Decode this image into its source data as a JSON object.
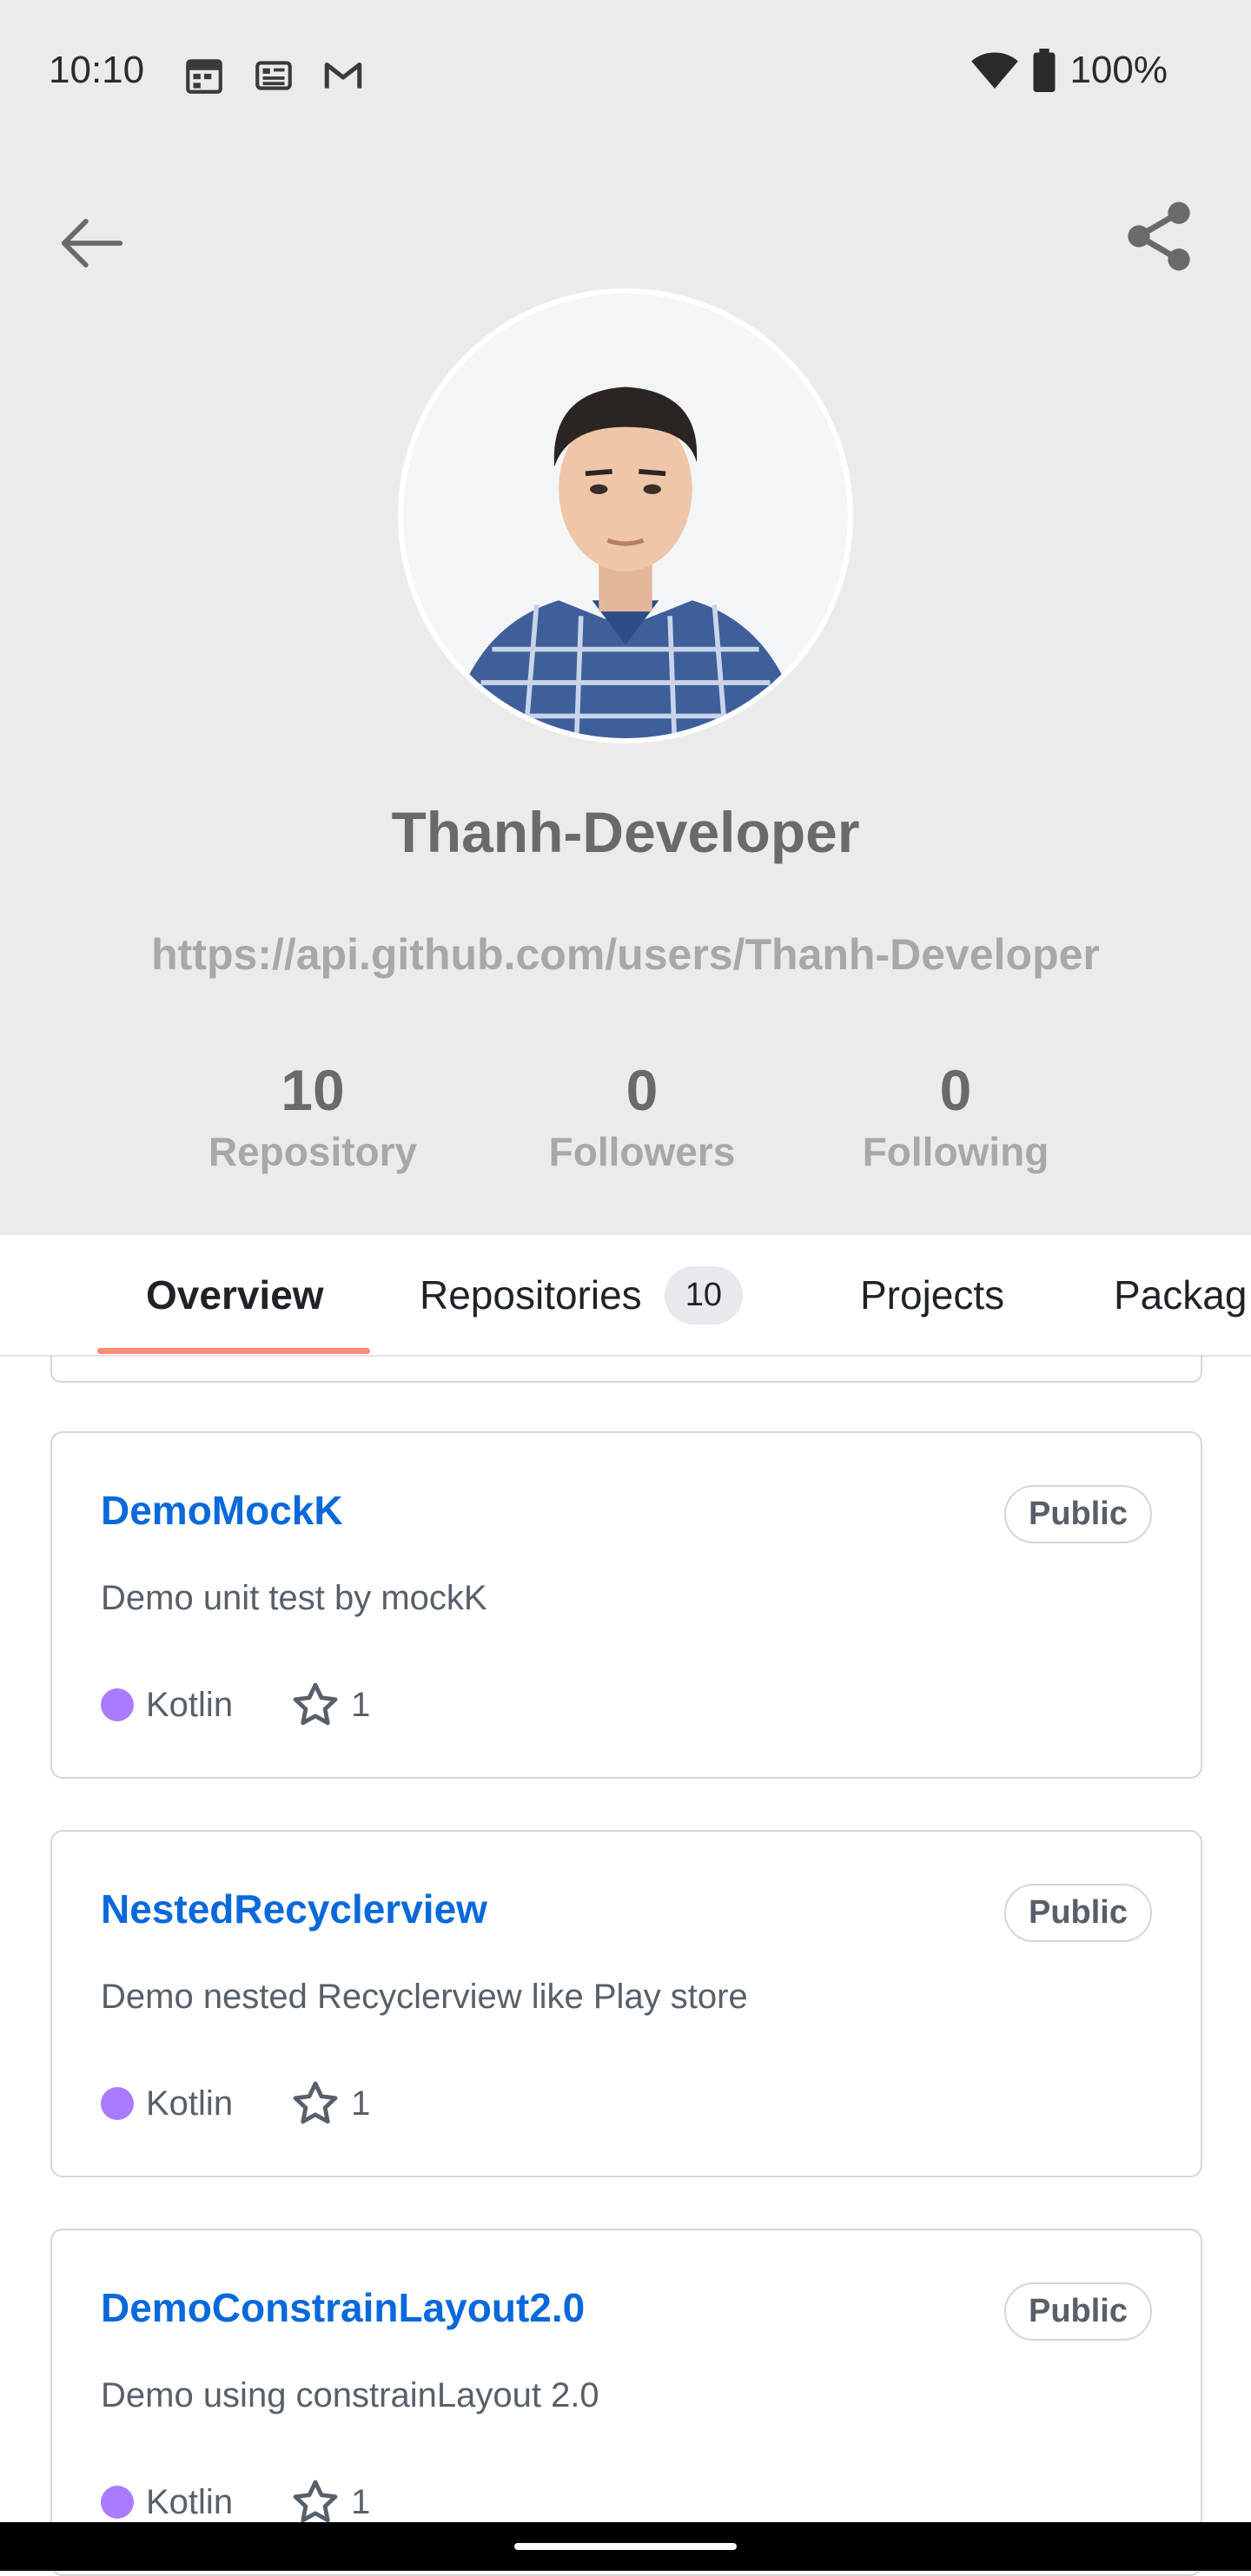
{
  "status_bar": {
    "time": "10:10",
    "battery_percent": "100%",
    "left_icons": [
      "calendar-icon",
      "news-icon",
      "gmail-icon"
    ],
    "right_icons": [
      "wifi-icon",
      "battery-icon"
    ]
  },
  "profile": {
    "username": "Thanh-Developer",
    "url": "https://api.github.com/users/Thanh-Developer",
    "stats": [
      {
        "value": "10",
        "label": "Repository"
      },
      {
        "value": "0",
        "label": "Followers"
      },
      {
        "value": "0",
        "label": "Following"
      }
    ]
  },
  "tabs": {
    "items": [
      {
        "label": "Overview",
        "active": true
      },
      {
        "label": "Repositories",
        "count": "10"
      },
      {
        "label": "Projects"
      },
      {
        "label": "Packag"
      }
    ]
  },
  "repos": [
    {
      "name": "DemoMockK",
      "visibility": "Public",
      "description": "Demo unit test by mockK",
      "language": "Kotlin",
      "stars": "1"
    },
    {
      "name": "NestedRecyclerview",
      "visibility": "Public",
      "description": "Demo nested Recyclerview like Play store",
      "language": "Kotlin",
      "stars": "1"
    },
    {
      "name": "DemoConstrainLayout2.0",
      "visibility": "Public",
      "description": "Demo using constrainLayout 2.0",
      "language": "Kotlin",
      "stars": "1"
    }
  ],
  "colors": {
    "header_bg": "#ebebeb",
    "link_blue": "#0969da",
    "kotlin_purple": "#a97bff",
    "tab_underline": "#fd8c73"
  }
}
